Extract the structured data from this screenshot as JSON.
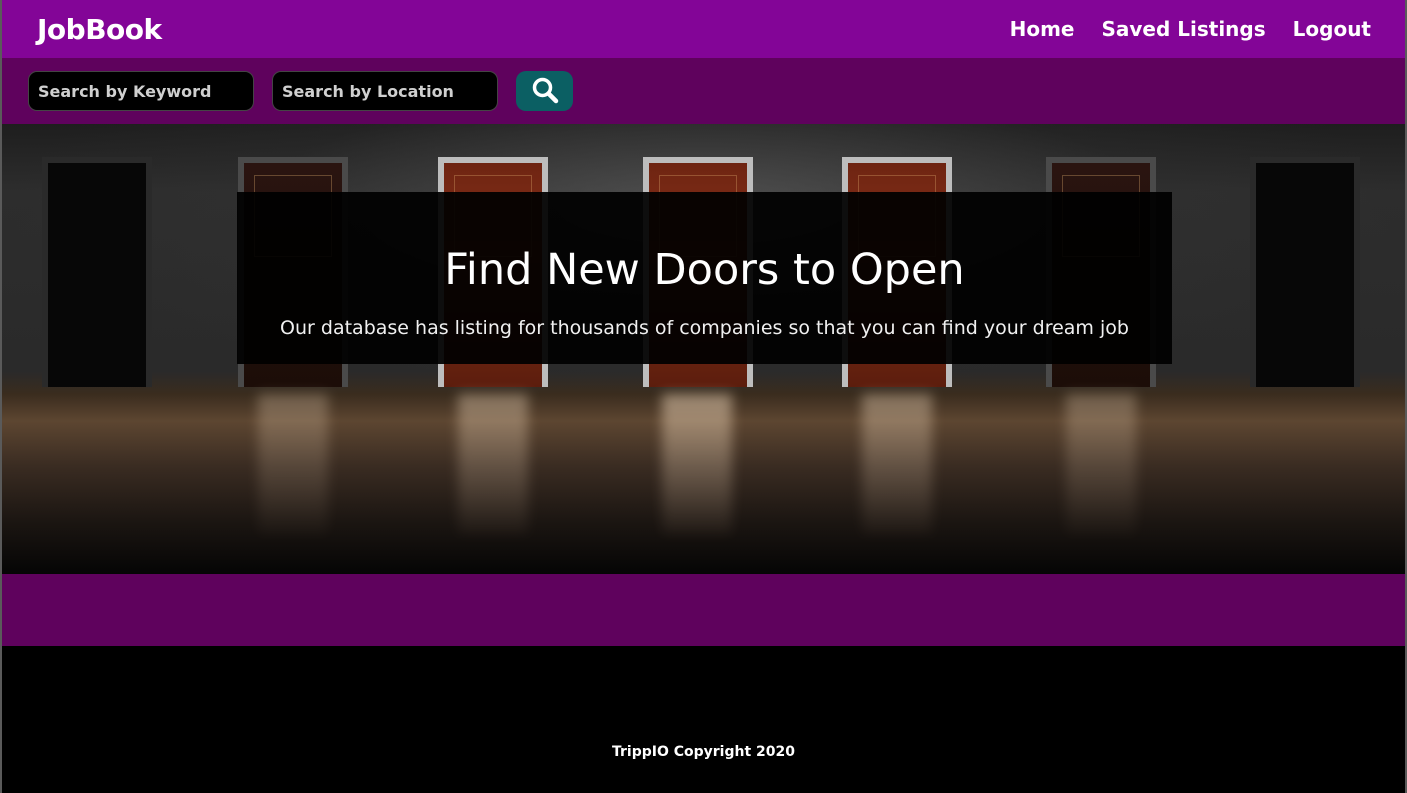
{
  "navbar": {
    "brand": "JobBook",
    "links": [
      "Home",
      "Saved Listings",
      "Logout"
    ]
  },
  "search": {
    "keyword_placeholder": "Search by Keyword",
    "location_placeholder": "Search by Location",
    "button_icon": "search-icon"
  },
  "hero": {
    "title": "Find New Doors to Open",
    "subtitle": "Our database has listing for thousands of companies so that you can find your dream job"
  },
  "footer": {
    "text": "TrippIO Copyright 2020"
  },
  "colors": {
    "navbar": "#830597",
    "search_row": "#5f025d",
    "search_button": "#0b5f63",
    "band": "#5f025d",
    "footer": "#000000"
  }
}
